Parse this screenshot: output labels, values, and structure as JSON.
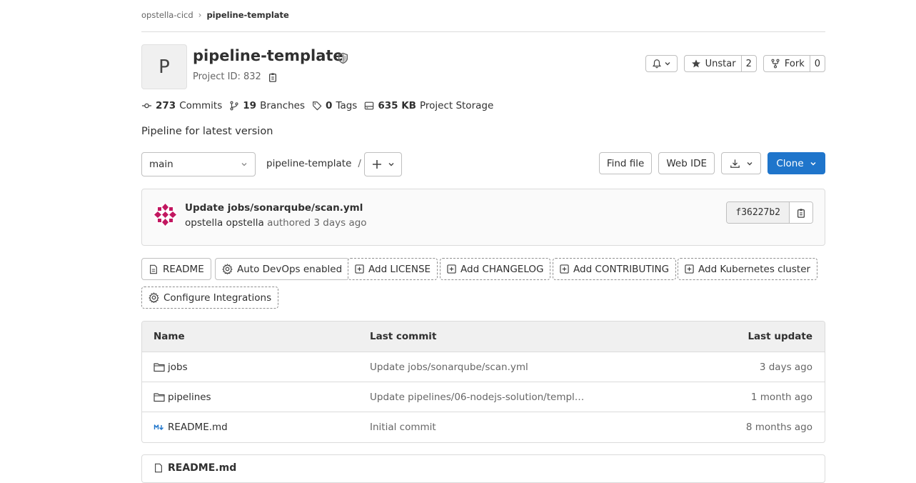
{
  "breadcrumb": {
    "group": "opstella-cicd",
    "project": "pipeline-template"
  },
  "project": {
    "avatar_letter": "P",
    "title": "pipeline-template",
    "id_text": "Project ID: 832",
    "description": "Pipeline for latest version"
  },
  "actions": {
    "star_label": "Unstar",
    "star_count": "2",
    "fork_label": "Fork",
    "fork_count": "0"
  },
  "stats": {
    "commits_count": "273",
    "commits_label": "Commits",
    "branches_count": "19",
    "branches_label": "Branches",
    "tags_count": "0",
    "tags_label": "Tags",
    "storage_size": "635 KB",
    "storage_label": "Project Storage"
  },
  "controls": {
    "branch": "main",
    "path": "pipeline-template",
    "path_sep": "/",
    "find_file": "Find file",
    "web_ide": "Web IDE",
    "clone": "Clone"
  },
  "last_commit": {
    "title": "Update jobs/sonarqube/scan.yml",
    "author": "opstella opstella",
    "meta": "authored 3 days ago",
    "sha": "f36227b2"
  },
  "quick_links": [
    {
      "label": "README",
      "icon": "file-icon",
      "style": "solid"
    },
    {
      "label": "Auto DevOps enabled",
      "icon": "gear-icon",
      "style": "solid"
    },
    {
      "label": "Add LICENSE",
      "icon": "plus-square-icon",
      "style": "dashed"
    },
    {
      "label": "Add CHANGELOG",
      "icon": "plus-square-icon",
      "style": "dashed"
    },
    {
      "label": "Add CONTRIBUTING",
      "icon": "plus-square-icon",
      "style": "dashed"
    },
    {
      "label": "Add Kubernetes cluster",
      "icon": "plus-square-icon",
      "style": "dashed"
    },
    {
      "label": "Configure Integrations",
      "icon": "gear-icon",
      "style": "dashed"
    }
  ],
  "file_table": {
    "headers": {
      "name": "Name",
      "last_commit": "Last commit",
      "last_update": "Last update"
    },
    "rows": [
      {
        "name": "jobs",
        "type": "folder",
        "commit": "Update jobs/sonarqube/scan.yml",
        "updated": "3 days ago"
      },
      {
        "name": "pipelines",
        "type": "folder",
        "commit": "Update pipelines/06-nodejs-solution/templ…",
        "updated": "1 month ago"
      },
      {
        "name": "README.md",
        "type": "markdown",
        "commit": "Initial commit",
        "updated": "8 months ago"
      }
    ]
  },
  "readme": {
    "title": "README.md"
  },
  "colors": {
    "primary": "#1f75cb",
    "border": "#dbdbdb",
    "muted": "#666666",
    "markdown_icon": "#1f75cb"
  }
}
